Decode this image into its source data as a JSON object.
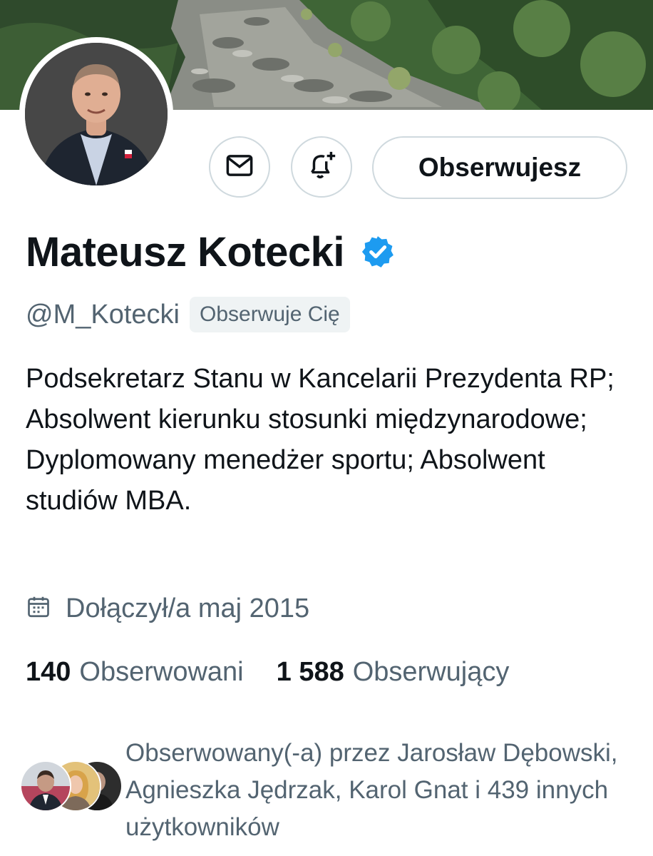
{
  "profile": {
    "display_name": "Mateusz Kotecki",
    "handle": "@M_Kotecki",
    "follows_you_badge": "Obserwuje Cię",
    "bio": "Podsekretarz Stanu w Kancelarii Prezydenta RP; Absolwent kierunku stosunki międzynarodowe; Dyplomowany menedżer sportu; Absolwent studiów MBA.",
    "joined": "Dołączył/a maj 2015",
    "verified": true
  },
  "actions": {
    "message_icon": "envelope-icon",
    "notify_icon": "bell-plus-icon",
    "follow_label": "Obserwujesz"
  },
  "stats": {
    "following_count": "140",
    "following_label": "Obserwowani",
    "followers_count": "1 588",
    "followers_label": "Obserwujący"
  },
  "followed_by": {
    "text": "Obserwowany(-a) przez Jarosław Dębowski, Agnieszka Jędrzak, Karol Gnat i 439 innych użytkowników"
  },
  "colors": {
    "verified_blue": "#1d9bf0",
    "text_primary": "#0f1419",
    "text_secondary": "#536471",
    "border": "#cfd9de"
  }
}
